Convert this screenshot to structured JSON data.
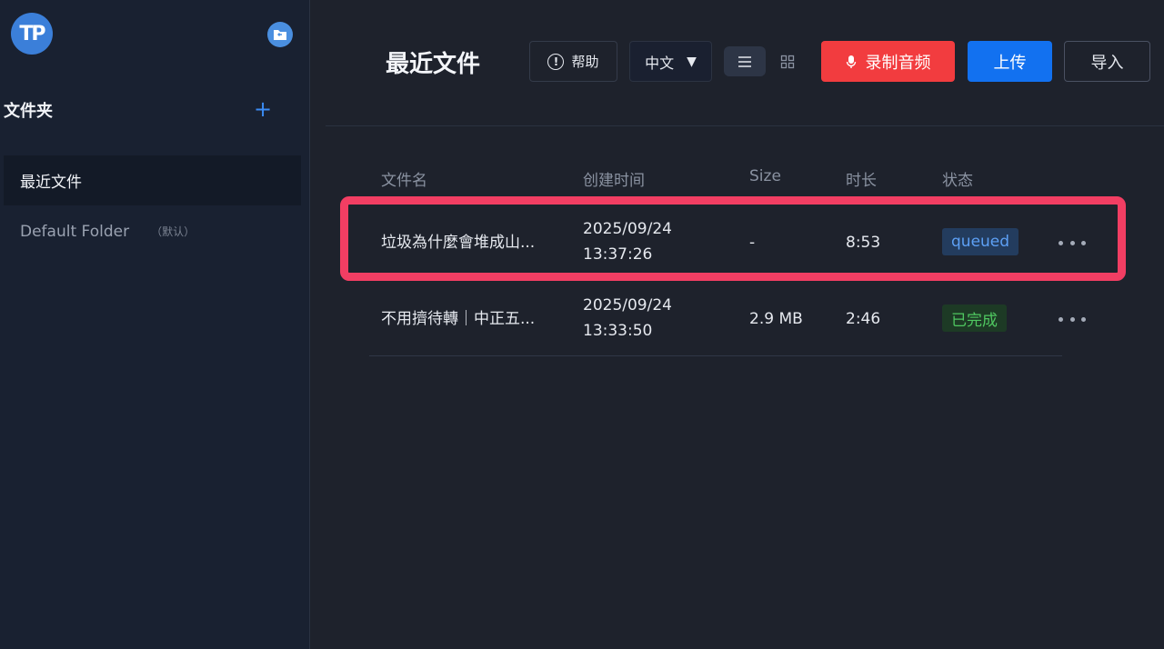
{
  "sidebar": {
    "logo_text": "TP",
    "folders_heading": "文件夹",
    "add_symbol": "+",
    "items": [
      {
        "label": "最近文件",
        "active": true
      },
      {
        "label": "Default Folder",
        "tag": "（默认）",
        "active": false
      }
    ]
  },
  "header": {
    "title": "最近文件",
    "help_label": "帮助",
    "help_icon_glyph": "!",
    "language": "中文",
    "record_label": "录制音频",
    "upload_label": "上传",
    "import_label": "导入"
  },
  "table": {
    "columns": [
      "文件名",
      "创建时间",
      "Size",
      "时长",
      "状态"
    ],
    "rows": [
      {
        "name": "垃圾為什麼會堆成山...",
        "date": "2025/09/24",
        "time": "13:37:26",
        "size": "-",
        "duration": "8:53",
        "status": "queued",
        "status_color": "#5da0f5"
      },
      {
        "name": "不用擠待轉｜中正五...",
        "date": "2025/09/24",
        "time": "13:33:50",
        "size": "2.9 MB",
        "duration": "2:46",
        "status": "已完成",
        "status_color": "#4fc760"
      }
    ]
  },
  "colors": {
    "accent": "#1271f0",
    "record": "#f23c3f",
    "highlight": "#f23e63"
  }
}
